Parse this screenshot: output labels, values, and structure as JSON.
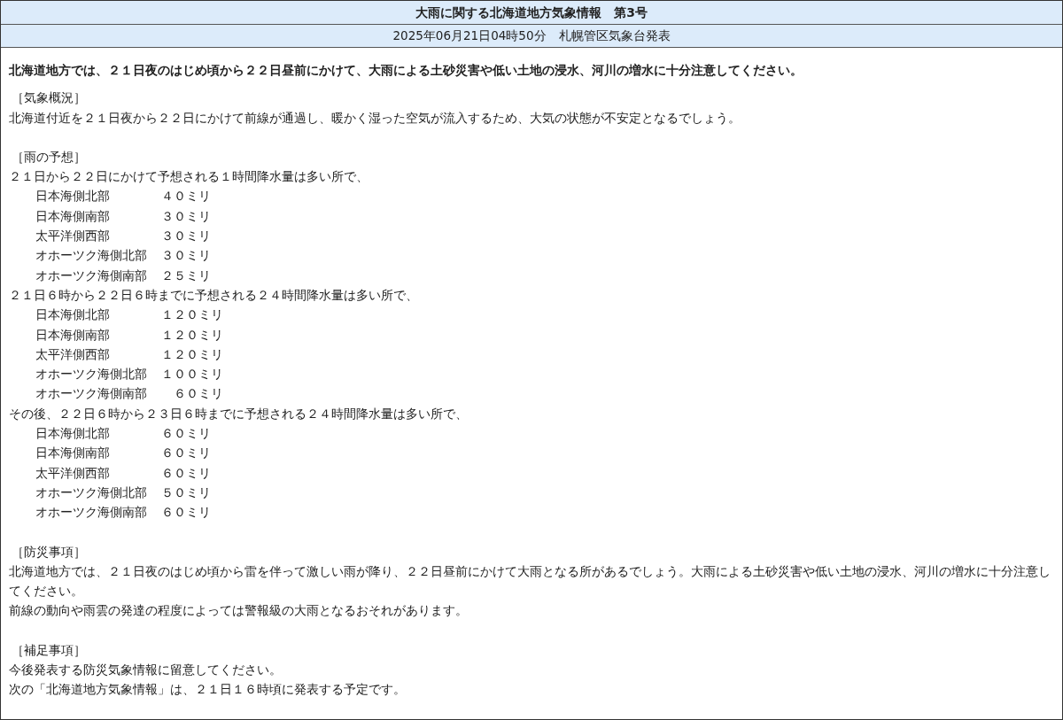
{
  "title": "大雨に関する北海道地方気象情報　第3号",
  "issued": "2025年06月21日04時50分　札幌管区気象台発表",
  "headline": "北海道地方では、２１日夜のはじめ頃から２２日昼前にかけて、大雨による土砂災害や低い土地の浸水、河川の増水に十分注意してください。",
  "sections": [
    {
      "heading": "［気象概況］",
      "blocks": [
        {
          "kind": "text",
          "text": "北海道付近を２１日夜から２２日にかけて前線が通過し、暖かく湿った空気が流入するため、大気の状態が不安定となるでしょう。"
        }
      ]
    },
    {
      "heading": "［雨の予想］",
      "blocks": [
        {
          "kind": "text",
          "text": "２１日から２２日にかけて予想される１時間降水量は多い所で、"
        },
        {
          "kind": "amounts",
          "rows": [
            {
              "region": "日本海側北部",
              "amount": "４０ミリ"
            },
            {
              "region": "日本海側南部",
              "amount": "３０ミリ"
            },
            {
              "region": "太平洋側西部",
              "amount": "３０ミリ"
            },
            {
              "region": "オホーツク海側北部",
              "amount": "３０ミリ"
            },
            {
              "region": "オホーツク海側南部",
              "amount": "２５ミリ"
            }
          ]
        },
        {
          "kind": "text",
          "text": "２１日６時から２２日６時までに予想される２４時間降水量は多い所で、"
        },
        {
          "kind": "amounts",
          "rows": [
            {
              "region": "日本海側北部",
              "amount": "１２０ミリ"
            },
            {
              "region": "日本海側南部",
              "amount": "１２０ミリ"
            },
            {
              "region": "太平洋側西部",
              "amount": "１２０ミリ"
            },
            {
              "region": "オホーツク海側北部",
              "amount": "１００ミリ"
            },
            {
              "region": "オホーツク海側南部",
              "amount": "６０ミリ"
            }
          ]
        },
        {
          "kind": "text",
          "text": "その後、２２日６時から２３日６時までに予想される２４時間降水量は多い所で、"
        },
        {
          "kind": "amounts",
          "rows": [
            {
              "region": "日本海側北部",
              "amount": "６０ミリ"
            },
            {
              "region": "日本海側南部",
              "amount": "６０ミリ"
            },
            {
              "region": "太平洋側西部",
              "amount": "６０ミリ"
            },
            {
              "region": "オホーツク海側北部",
              "amount": "５０ミリ"
            },
            {
              "region": "オホーツク海側南部",
              "amount": "６０ミリ"
            }
          ]
        }
      ]
    },
    {
      "heading": "［防災事項］",
      "blocks": [
        {
          "kind": "text",
          "text": "北海道地方では、２１日夜のはじめ頃から雷を伴って激しい雨が降り、２２日昼前にかけて大雨となる所があるでしょう。大雨による土砂災害や低い土地の浸水、河川の増水に十分注意してください。"
        },
        {
          "kind": "text",
          "text": "前線の動向や雨雲の発達の程度によっては警報級の大雨となるおそれがあります。"
        }
      ]
    },
    {
      "heading": "［補足事項］",
      "blocks": [
        {
          "kind": "text",
          "text": "今後発表する防災気象情報に留意してください。"
        },
        {
          "kind": "text",
          "text": "次の「北海道地方気象情報」は、２１日１６時頃に発表する予定です。"
        }
      ]
    }
  ]
}
